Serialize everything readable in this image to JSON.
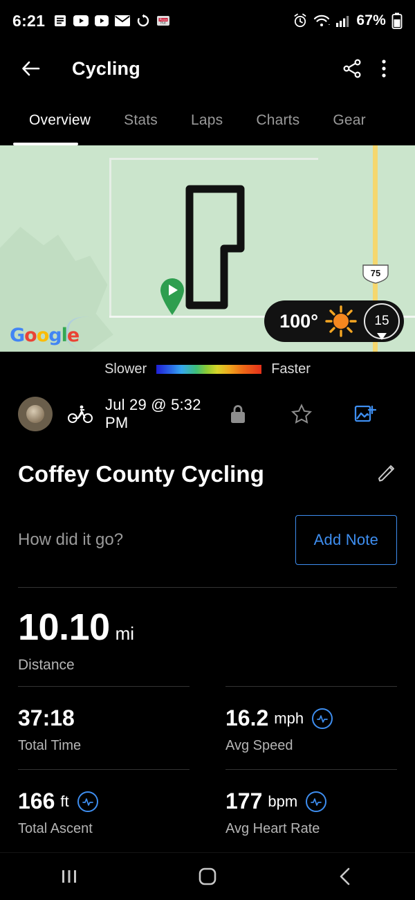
{
  "status_bar": {
    "time": "6:21",
    "battery_percent": "67%",
    "left_icons": [
      "email-app-icon",
      "youtube-icon",
      "youtube-music-icon",
      "gmail-icon",
      "sync-icon",
      "pizza-hut-icon"
    ],
    "right_icons": [
      "alarm-icon",
      "wifi-icon",
      "cellular-signal-icon",
      "battery-icon"
    ]
  },
  "app_bar": {
    "back_label": "back-arrow",
    "title": "Cycling",
    "share_label": "share",
    "overflow_label": "more-options"
  },
  "tabs": [
    {
      "label": "Overview",
      "active": true
    },
    {
      "label": "Stats",
      "active": false
    },
    {
      "label": "Laps",
      "active": false
    },
    {
      "label": "Charts",
      "active": false
    },
    {
      "label": "Gear",
      "active": false
    }
  ],
  "map": {
    "provider_logo": [
      "G",
      "o",
      "o",
      "g",
      "l",
      "e"
    ],
    "highway_shield": "75",
    "weather": {
      "temperature": "100°",
      "condition_icon": "sun-icon",
      "wind_speed": "15"
    }
  },
  "legend": {
    "slower_label": "Slower",
    "faster_label": "Faster",
    "colors": [
      "#1f1fd6",
      "#36a8ef",
      "#3fbf7a",
      "#8ecb35",
      "#d7d42a",
      "#f0a51e",
      "#ef6b17",
      "#e5311a"
    ]
  },
  "meta": {
    "activity_type_icon": "cycling-icon",
    "date": "Jul 29 @ 5:32 PM",
    "privacy_icon": "lock-icon",
    "favorite_icon": "star-icon",
    "add_photo_icon": "add-photo-icon"
  },
  "activity": {
    "title": "Coffey County Cycling",
    "edit_icon": "pencil-icon"
  },
  "note": {
    "placeholder": "How did it go?",
    "button_label": "Add Note"
  },
  "stats": {
    "primary": {
      "value": "10.10",
      "unit": "mi",
      "label": "Distance"
    },
    "items": [
      {
        "value": "37:18",
        "unit": "",
        "label": "Total Time",
        "badge": false
      },
      {
        "value": "16.2",
        "unit": "mph",
        "label": "Avg Speed",
        "badge": true
      },
      {
        "value": "166",
        "unit": "ft",
        "label": "Total Ascent",
        "badge": true
      },
      {
        "value": "177",
        "unit": "bpm",
        "label": "Avg Heart Rate",
        "badge": true
      }
    ]
  },
  "nav_bar": {
    "recents_label": "recents",
    "home_label": "home",
    "back_label": "back"
  },
  "colors": {
    "accent": "#3e8ef0",
    "background": "#000000",
    "map_green": "#cbe5cc",
    "muted_text": "#b5b5b5"
  }
}
